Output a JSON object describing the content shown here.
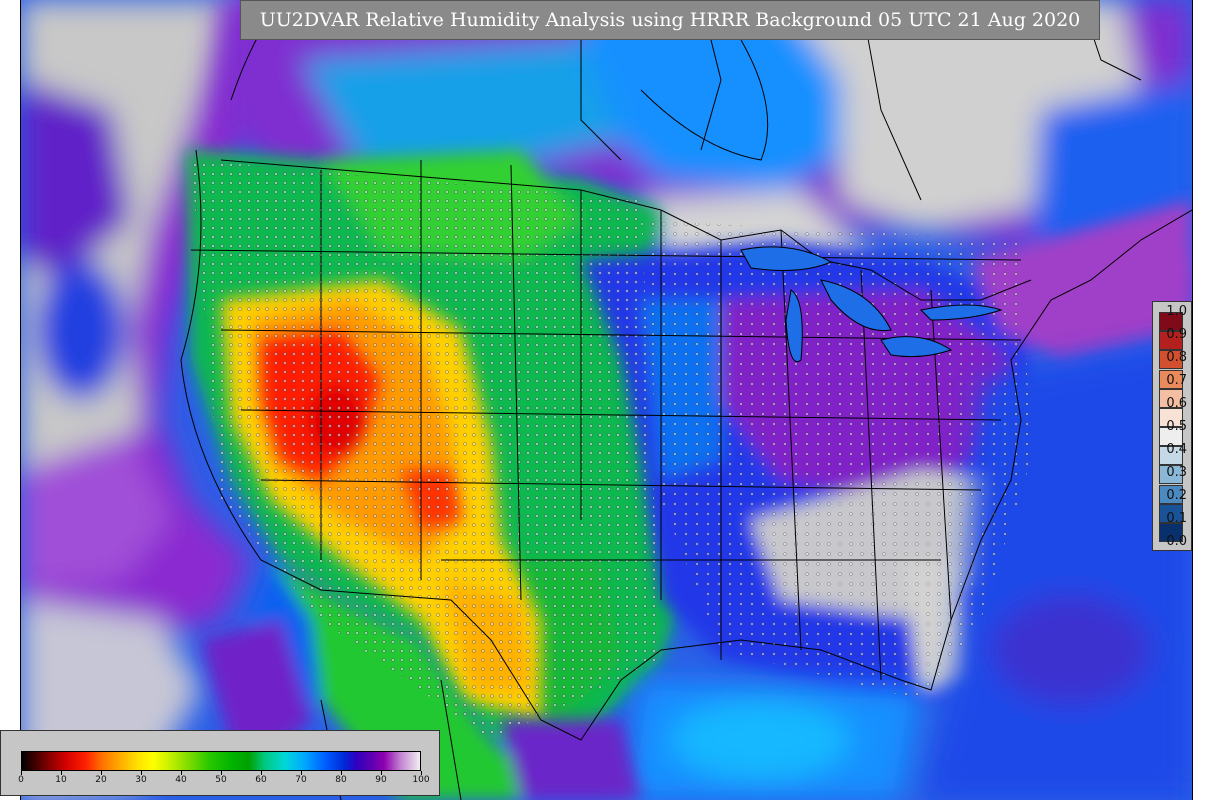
{
  "title": "UU2DVAR Relative Humidity Analysis using HRRR Background 05 UTC 21 Aug 2020",
  "right_legend": {
    "labels": [
      "1.0",
      "0.9",
      "0.8",
      "0.7",
      "0.6",
      "0.5",
      "0.4",
      "0.3",
      "0.2",
      "0.1",
      "0.0"
    ],
    "colors": [
      "#7f0a1a",
      "#b3201e",
      "#d24f30",
      "#e98a5d",
      "#f3bea2",
      "#f8e2d6",
      "#eeeeee",
      "#c5d8e6",
      "#8cb8d8",
      "#4a8ac0",
      "#1a5298",
      "#08306b"
    ]
  },
  "bottom_legend": {
    "ticks": [
      "0",
      "10",
      "20",
      "30",
      "40",
      "50",
      "60",
      "70",
      "80",
      "90",
      "100"
    ]
  },
  "colors": {
    "ocean": "#2a5ce8",
    "land_moist": "#00b060",
    "dry_red": "#ff1a00",
    "dry_orange": "#ffb000",
    "humid_purple": "#7a00c0",
    "saturated_gray": "#d0d0d0"
  }
}
